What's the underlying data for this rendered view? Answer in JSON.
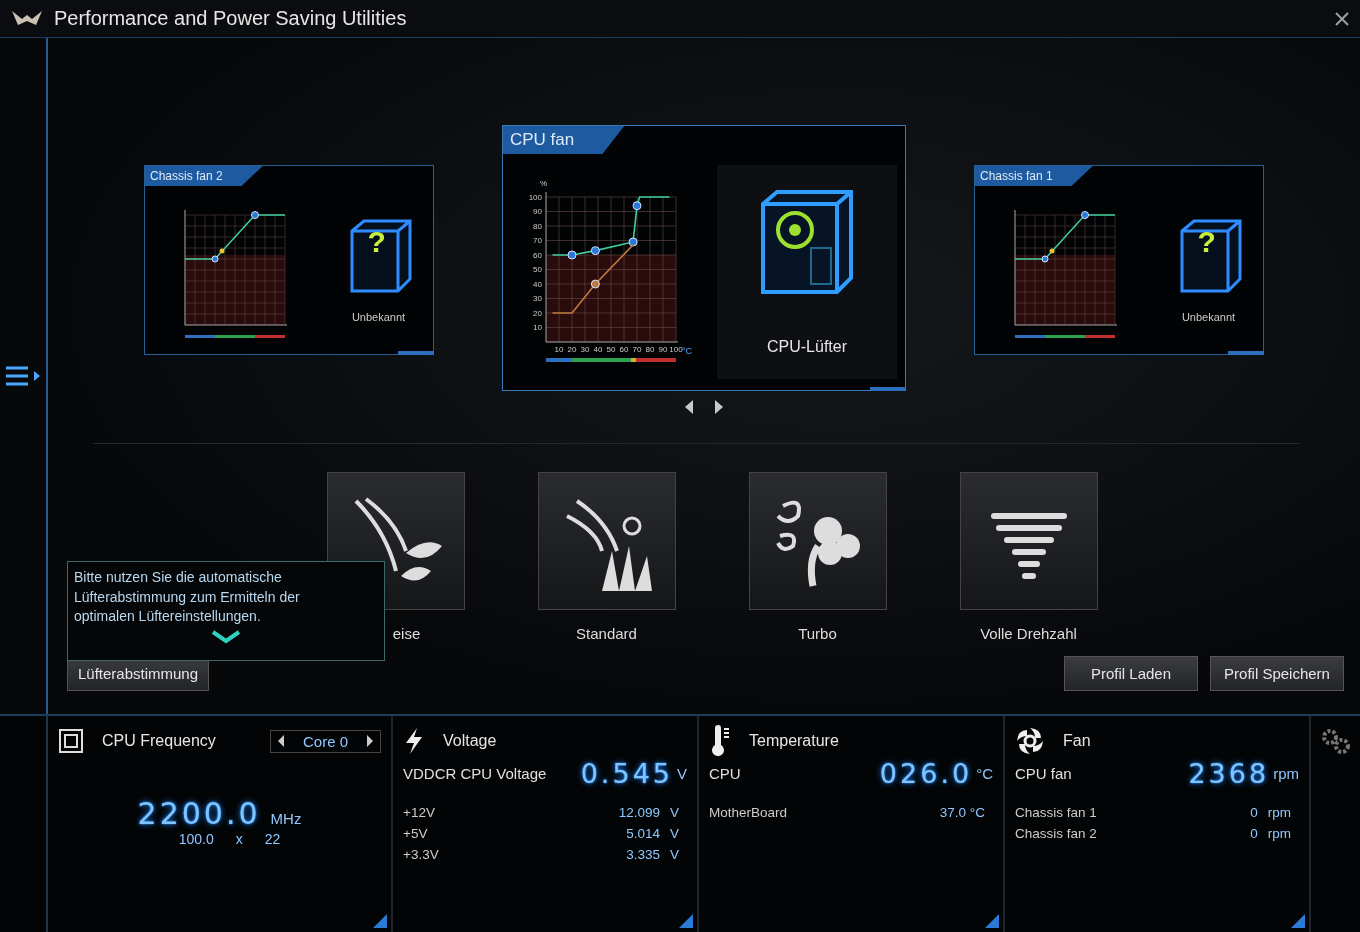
{
  "window": {
    "title": "Performance and Power Saving Utilities"
  },
  "fan_cards": [
    {
      "title": "Chassis fan 2",
      "device": "Unbekannt",
      "badge": "?",
      "kind": "unknown",
      "selected": false
    },
    {
      "title": "CPU fan",
      "device": "CPU-Lüfter",
      "kind": "cpu",
      "selected": true,
      "chart_data": {
        "type": "line",
        "xlabel": "°C",
        "ylabel": "%",
        "grid": true,
        "bands": [
          {
            "axis": "y",
            "from": 0,
            "to": 60,
            "color": "#2a0c0c"
          }
        ],
        "x": [
          5,
          20,
          38,
          67,
          70,
          72,
          95
        ],
        "xlim": [
          0,
          100
        ],
        "ylim": [
          0,
          100
        ],
        "xticks": [
          10,
          20,
          30,
          40,
          50,
          60,
          70,
          80,
          90,
          100
        ],
        "yticks": [
          10,
          20,
          30,
          40,
          50,
          60,
          70,
          80,
          90,
          100
        ],
        "series": [
          {
            "color": "#3fd0a0",
            "values": [
              60,
              60,
              63,
              69,
              94,
              100,
              100
            ]
          },
          {
            "color": "#c07a40",
            "values": [
              20,
              20,
              40,
              67,
              null,
              null,
              null
            ]
          }
        ]
      }
    },
    {
      "title": "Chassis fan 1",
      "device": "Unbekannt",
      "badge": "?",
      "kind": "unknown",
      "selected": false
    }
  ],
  "modes": [
    {
      "label": "eise",
      "kind": "silent",
      "selected": false
    },
    {
      "label": "Standard",
      "kind": "standard",
      "selected": false
    },
    {
      "label": "Turbo",
      "kind": "turbo",
      "selected": false
    },
    {
      "label": "Volle Drehzahl",
      "kind": "full",
      "selected": false
    }
  ],
  "tooltip": "Bitte nutzen Sie die automatische Lüfterabstimmung zum Ermitteln der optimalen Lüftereinstellungen.",
  "buttons": {
    "tuning": "Lüfterabstimmung",
    "load": "Profil Laden",
    "save": "Profil Speichern"
  },
  "monitor_panels": [
    {
      "kind": "frequency",
      "title": "CPU Frequency",
      "core": "Core 0",
      "value": "2200.0",
      "unit": "MHz",
      "base": "100.0",
      "times": "x",
      "multiplier": "22"
    },
    {
      "kind": "voltage",
      "title": "Voltage",
      "main": {
        "label": "VDDCR CPU Voltage",
        "value": "0.545",
        "unit": "V"
      },
      "rows": [
        {
          "label": "+12V",
          "value": "12.099",
          "unit": "V"
        },
        {
          "label": "+5V",
          "value": "5.014",
          "unit": "V"
        },
        {
          "label": "+3.3V",
          "value": "3.335",
          "unit": "V"
        }
      ]
    },
    {
      "kind": "temperature",
      "title": "Temperature",
      "main": {
        "label": "CPU",
        "value": "026.0",
        "unit": "°C"
      },
      "rows": [
        {
          "label": "MotherBoard",
          "value": "37.0 °C"
        }
      ]
    },
    {
      "kind": "fan",
      "title": "Fan",
      "main": {
        "label": "CPU fan",
        "value": "2368",
        "unit": "rpm"
      },
      "rows": [
        {
          "label": "Chassis fan 1",
          "value": "0",
          "unit": "rpm"
        },
        {
          "label": "Chassis fan 2",
          "value": "0",
          "unit": "rpm"
        }
      ]
    }
  ]
}
